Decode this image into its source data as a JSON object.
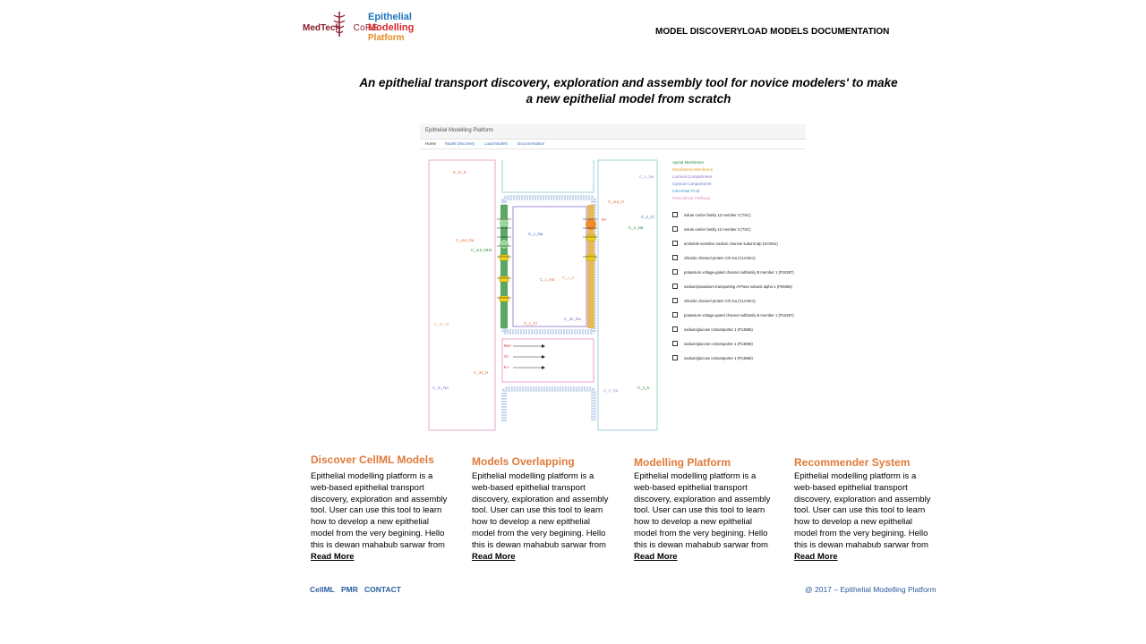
{
  "logo": {
    "medtech": "MedTech",
    "core": "CoRE",
    "line1": "Epithelial",
    "line2": "Modelling",
    "line3": "Platform"
  },
  "nav": {
    "model_discovery": "MODEL DISCOVERY",
    "load_models": "LOAD MODELS",
    "documentation": "DOCUMENTATION"
  },
  "headline": {
    "line1": "An epithelial transport discovery, exploration and assembly tool for novice modelers' to make",
    "line2": "a new epithelial model from scratch"
  },
  "preview": {
    "title": "Epithelial Modelling Platform",
    "tabs": [
      "Home",
      "Model Discovery",
      "Load Models",
      "Documentation"
    ],
    "legend": [
      {
        "label": "Apical Membrane",
        "color": "#2e8b3c"
      },
      {
        "label": "Basolateral Membrane",
        "color": "#e6a21e"
      },
      {
        "label": "Luminal Compartment",
        "color": "#8a6fc9"
      },
      {
        "label": "Cytosol Compartment",
        "color": "#5a7fd0"
      },
      {
        "label": "Interstitial Fluid",
        "color": "#4aa0c8"
      },
      {
        "label": "Paracellular Pathway",
        "color": "#e08ec0"
      }
    ],
    "checkboxes": [
      "solute carrier family 12 member 3 (TSC)",
      "solute carrier family 12 member 3 (TSC)",
      "amiloride-sensitive sodium channel subunit alp (SCNN1)",
      "chloride channel protein ClC-Ka (CLCNK1)",
      "potassium voltage-gated channel subfamily B member 1 (P15387)",
      "sodium/potassium-transporting ATPase subunit alpha-1 (P05665)",
      "chloride channel protein ClC-Ka (CLCNK1)",
      "potassium voltage-gated channel subfamily B member 1 (P15387)",
      "sodium/glucose cotransporter 1 (P13866)",
      "sodium/glucose cotransporter 1 (P13866)",
      "sodium/glucose cotransporter 1 (P13866)"
    ],
    "labels": {
      "c_m_k": "C_m_K",
      "c_c_na_top": "C_c_Na",
      "c_out_na": "C_out_Na",
      "c_out_nh4": "C_out_NH4",
      "c_m_cl": "C_m_Cl",
      "c_m_na": "C_m_Na",
      "c_out_h": "C_out_H",
      "c_s_cl": "C_s_Cl",
      "c_s_na": "C_s_Na",
      "c_s_na_bottom": "C_s_Na",
      "c_s_k": "C_s_K",
      "c_c_na_mid": "C_c_Na",
      "c_c_na_low": "C_c_Na",
      "c_c_k": "C_c_K",
      "c_c_cl": "C_c_Cl",
      "c_int_na": "C_int_Na",
      "c_int_h": "C_int_H",
      "na_plus": "Na+",
      "cl_minus": "Cl-",
      "k_plus": "K+",
      "h_plus": "H+"
    }
  },
  "features": [
    {
      "title": "Discover CellML Models",
      "body": "Epithelial modelling platform is a web-based epithelial transport discovery, exploration and assembly tool. User can use this tool to learn how to develop a new epithelial model from the very begining.  Hello this is dewan mahabub sarwar from ",
      "link": "Read More"
    },
    {
      "title": "Models Overlapping",
      "body": "Epithelial modelling platform is a web-based epithelial transport discovery, exploration and assembly tool. User can use this tool to learn how to develop a new epithelial model from the very begining.  Hello this is dewan mahabub sarwar from ",
      "link": "Read More"
    },
    {
      "title": "Modelling Platform",
      "body": "Epithelial modelling platform is a web-based epithelial transport discovery, exploration and assembly tool. User can use this tool to learn how to develop a new epithelial model from the very begining.  Hello this is dewan mahabub sarwar from ",
      "link": "Read More"
    },
    {
      "title": "Recommender System",
      "body": "Epithelial modelling platform is a web-based epithelial transport discovery, exploration and assembly tool. User can use this tool to learn how to develop a new epithelial model from the very begining.  Hello this is dewan mahabub sarwar from ",
      "link": "Read More"
    }
  ],
  "footer": {
    "links": [
      "CellML",
      "PMR",
      "CONTACT"
    ],
    "copyright": "@ 2017 – Epithelial Modelling Platform"
  }
}
